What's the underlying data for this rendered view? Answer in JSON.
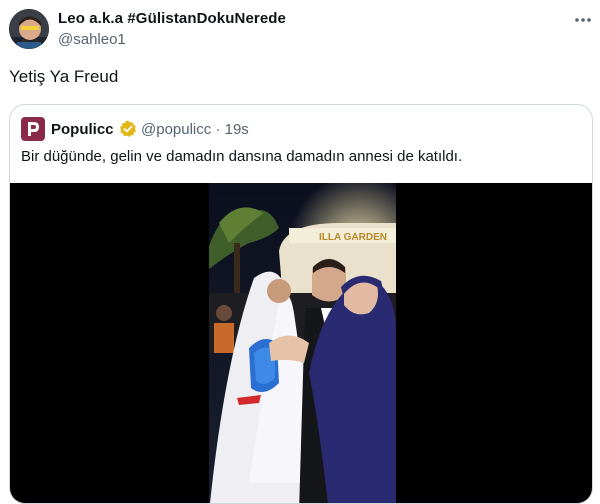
{
  "tweet": {
    "author_name": "Leo a.k.a #GülistanDokuNerede",
    "author_handle": "@sahleo1",
    "text": "Yetiş Ya Freud",
    "more_icon": "more-horizontal-icon"
  },
  "quote": {
    "author_name": "Populicc",
    "author_handle": "@populicc",
    "separator": "·",
    "time": "19s",
    "text": "Bir düğünde, gelin ve damadın dansına damadın annesi de katıldı.",
    "avatar_letter": "P",
    "verified_icon": "verified-badge-icon",
    "video_sign": "ILLA GARDEN"
  },
  "colors": {
    "text_primary": "#0f1419",
    "text_secondary": "#536471",
    "border": "#cfd9de",
    "quote_avatar": "#8a2a4a",
    "verified": "#e2b719"
  }
}
